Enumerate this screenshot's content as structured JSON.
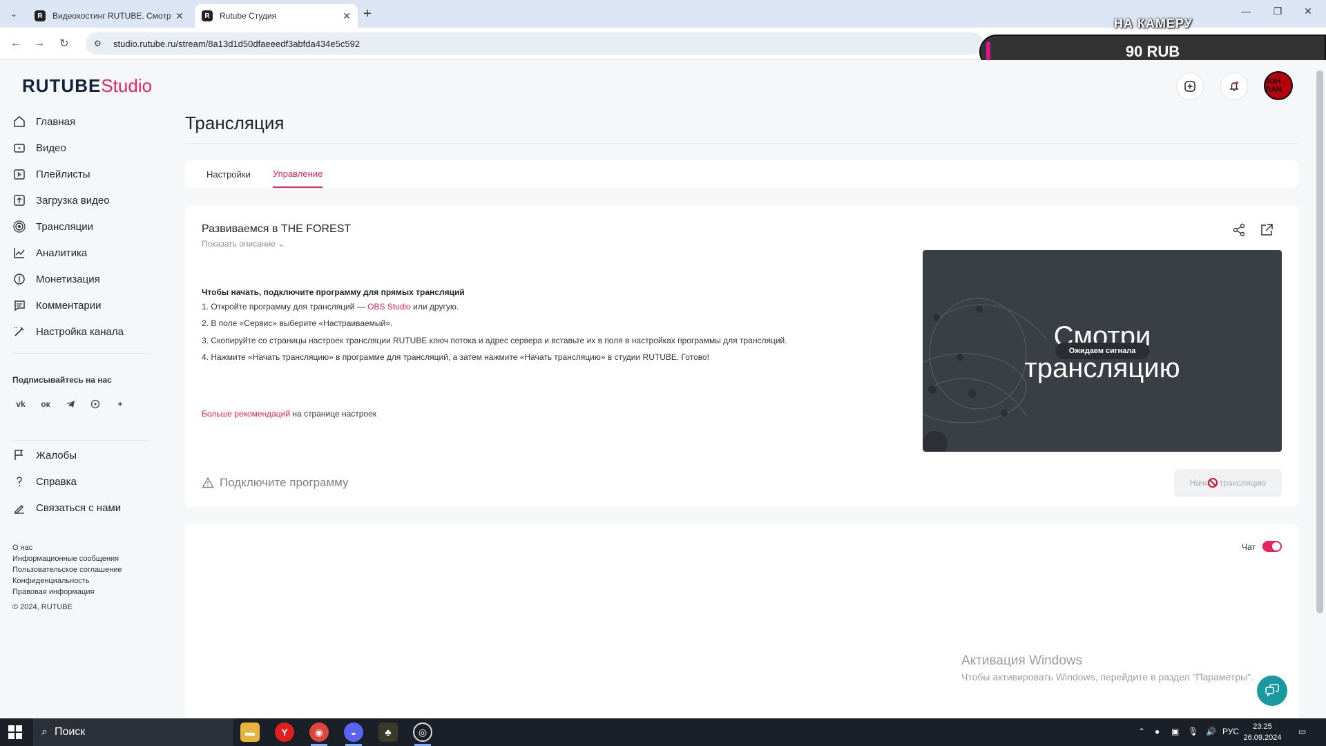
{
  "browser": {
    "tabs": [
      {
        "label": "Видеохостинг RUTUBE. Смотрите"
      },
      {
        "label": "Rutube Студия"
      }
    ],
    "url": "studio.rutube.ru/stream/8a13d1d50dfaeeedf3abfda434e5c592"
  },
  "overlay": {
    "caption": "НА КАМЕРУ",
    "amount": "90 RUB"
  },
  "brand": {
    "name": "RUTUBE",
    "suffix": "Studio"
  },
  "avatar_text": "JOH DAN",
  "sidebar": {
    "items": [
      {
        "label": "Главная",
        "icon": "home-icon"
      },
      {
        "label": "Видео",
        "icon": "video-icon"
      },
      {
        "label": "Плейлисты",
        "icon": "playlist-icon"
      },
      {
        "label": "Загрузка видео",
        "icon": "upload-icon"
      },
      {
        "label": "Трансляции",
        "icon": "broadcast-icon"
      },
      {
        "label": "Аналитика",
        "icon": "analytics-icon"
      },
      {
        "label": "Монетизация",
        "icon": "monetization-icon"
      },
      {
        "label": "Комментарии",
        "icon": "comments-icon"
      },
      {
        "label": "Настройка канала",
        "icon": "channel-settings-icon"
      }
    ],
    "follow_title": "Подписывайтесь на нас",
    "socials": [
      {
        "label": "vk",
        "icon": "vk-icon"
      },
      {
        "label": "ок",
        "icon": "ok-icon"
      },
      {
        "label": "tg",
        "icon": "telegram-icon"
      },
      {
        "label": "vb",
        "icon": "viber-icon"
      },
      {
        "label": "+",
        "icon": "plus-icon"
      }
    ],
    "secondary": [
      {
        "label": "Жалобы",
        "icon": "flag-icon"
      },
      {
        "label": "Справка",
        "icon": "help-icon"
      },
      {
        "label": "Связаться с нами",
        "icon": "contact-icon"
      }
    ],
    "footer_links": [
      "О нас",
      "Информационные сообщения",
      "Пользовательское соглашение",
      "Конфиденциальность",
      "Правовая информация"
    ],
    "copyright": "© 2024, RUTUBE"
  },
  "page": {
    "title": "Трансляция",
    "tabs": [
      {
        "label": "Настройки"
      },
      {
        "label": "Управление"
      }
    ]
  },
  "stream": {
    "title": "Развиваемся в THE FOREST",
    "show_description": "Показать описание",
    "instructions_title": "Чтобы начать, подключите программу для прямых трансляций",
    "step1_pre": "1. Откройте программу для трансляций — ",
    "step1_link": "OBS Studio",
    "step1_post": " или другую.",
    "step2": "2. В поле «Сервис» выберите «Настраиваемый».",
    "step3": "3. Скопируйте со страницы настроек трансляции RUTUBE ключ потока и адрес сервера и вставьте их в поля в настройках программы для трансляций.",
    "step4": "4. Нажмите «Начать трансляцию» в программе для трансляций, а затем нажмите «Начать трансляцию» в студии RUTUBE. Готово!",
    "more_link": "Больше рекомендаций",
    "more_post": " на странице настроек",
    "connect_status": "Подключите программу",
    "preview_text_1": "Смотри",
    "preview_text_2": "трансляцию",
    "preview_badge": "Ожидаем сигнала",
    "start_button": "Начать трансляцию"
  },
  "chat": {
    "label": "Чат",
    "enabled": true
  },
  "windows": {
    "activation_title": "Активация Windows",
    "activation_text": "Чтобы активировать Windows, перейдите в раздел \"Параметры\"."
  },
  "taskbar": {
    "search_placeholder": "Поиск",
    "lang": "РУС",
    "time": "23:25",
    "date": "26.09.2024"
  }
}
